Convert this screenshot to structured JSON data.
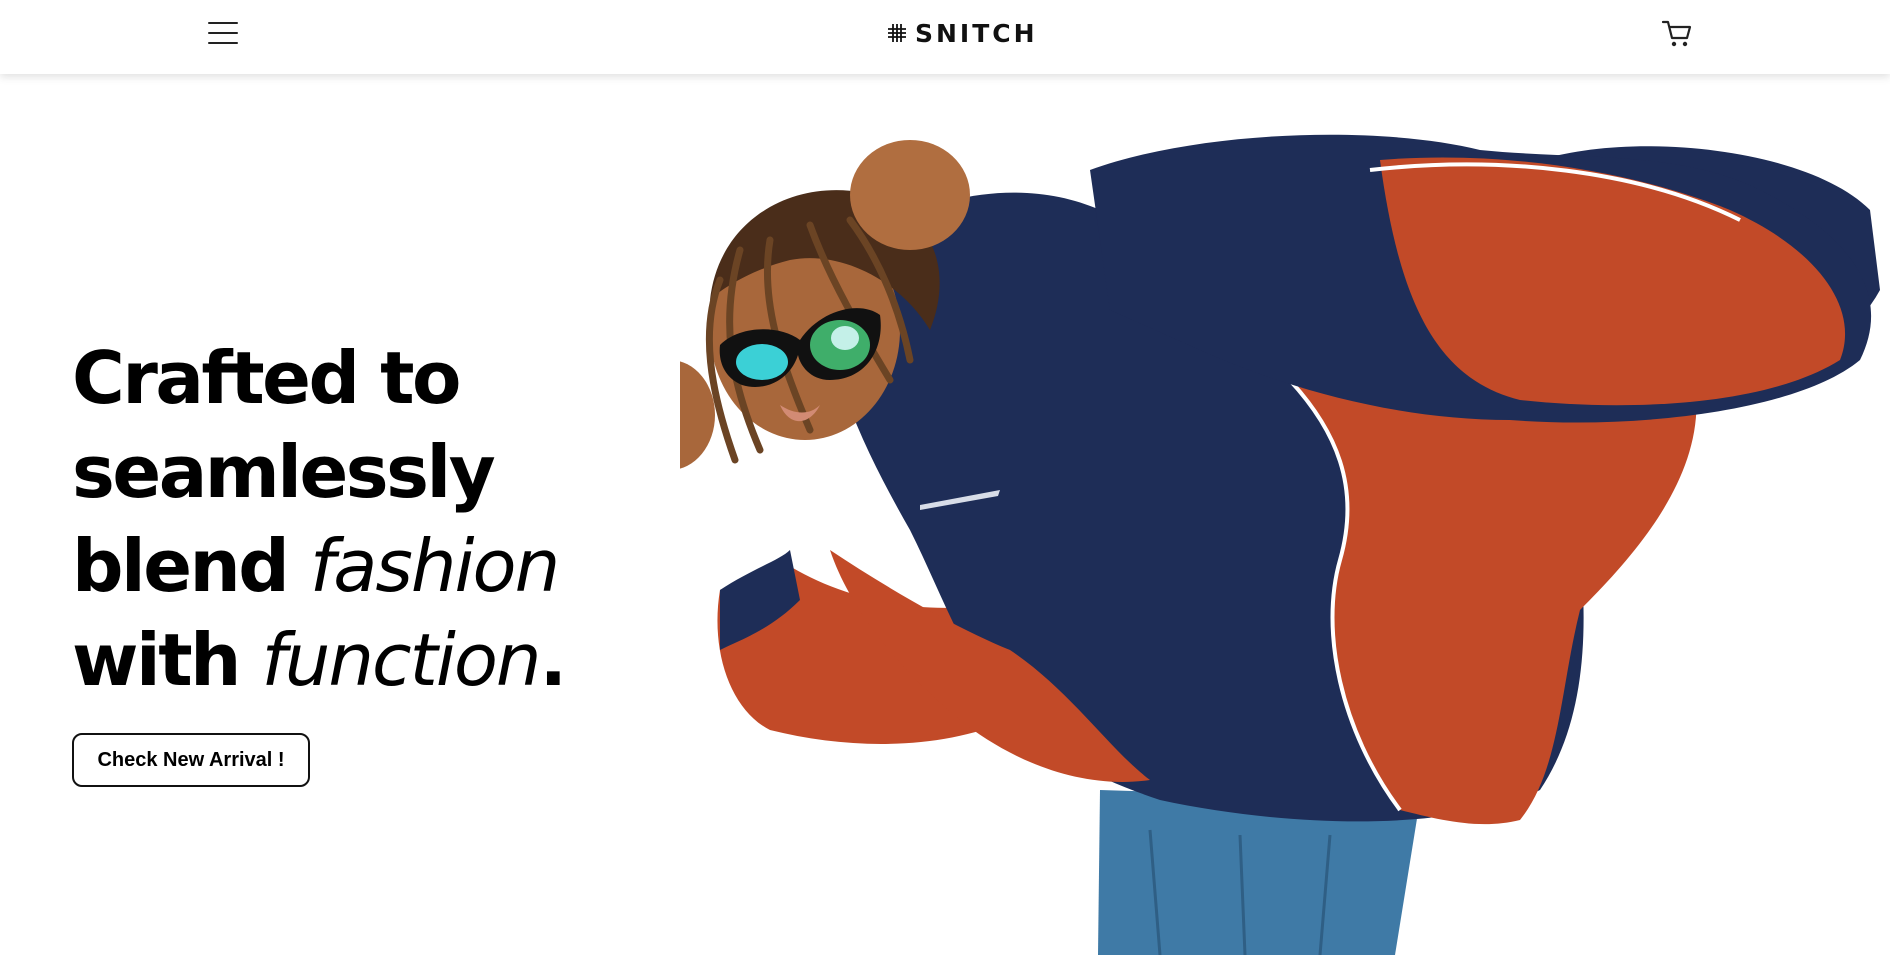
{
  "header": {
    "brand": "SNITCH",
    "menu_icon": "hamburger-menu-icon",
    "cart_icon": "shopping-cart-icon"
  },
  "hero": {
    "headline": {
      "line1": "Crafted to",
      "line2": "seamlessly",
      "line3_prefix": "blend ",
      "line3_italic": "fashion",
      "line4_prefix": "with ",
      "line4_italic": "function",
      "line4_suffix": "."
    },
    "cta_label": "Check New Arrival !"
  },
  "colors": {
    "navy": "#1e2d57",
    "rust": "#c24a28",
    "skin": "#a8673b",
    "denim": "#3f7aa6",
    "lens": "#3bd0d6"
  }
}
